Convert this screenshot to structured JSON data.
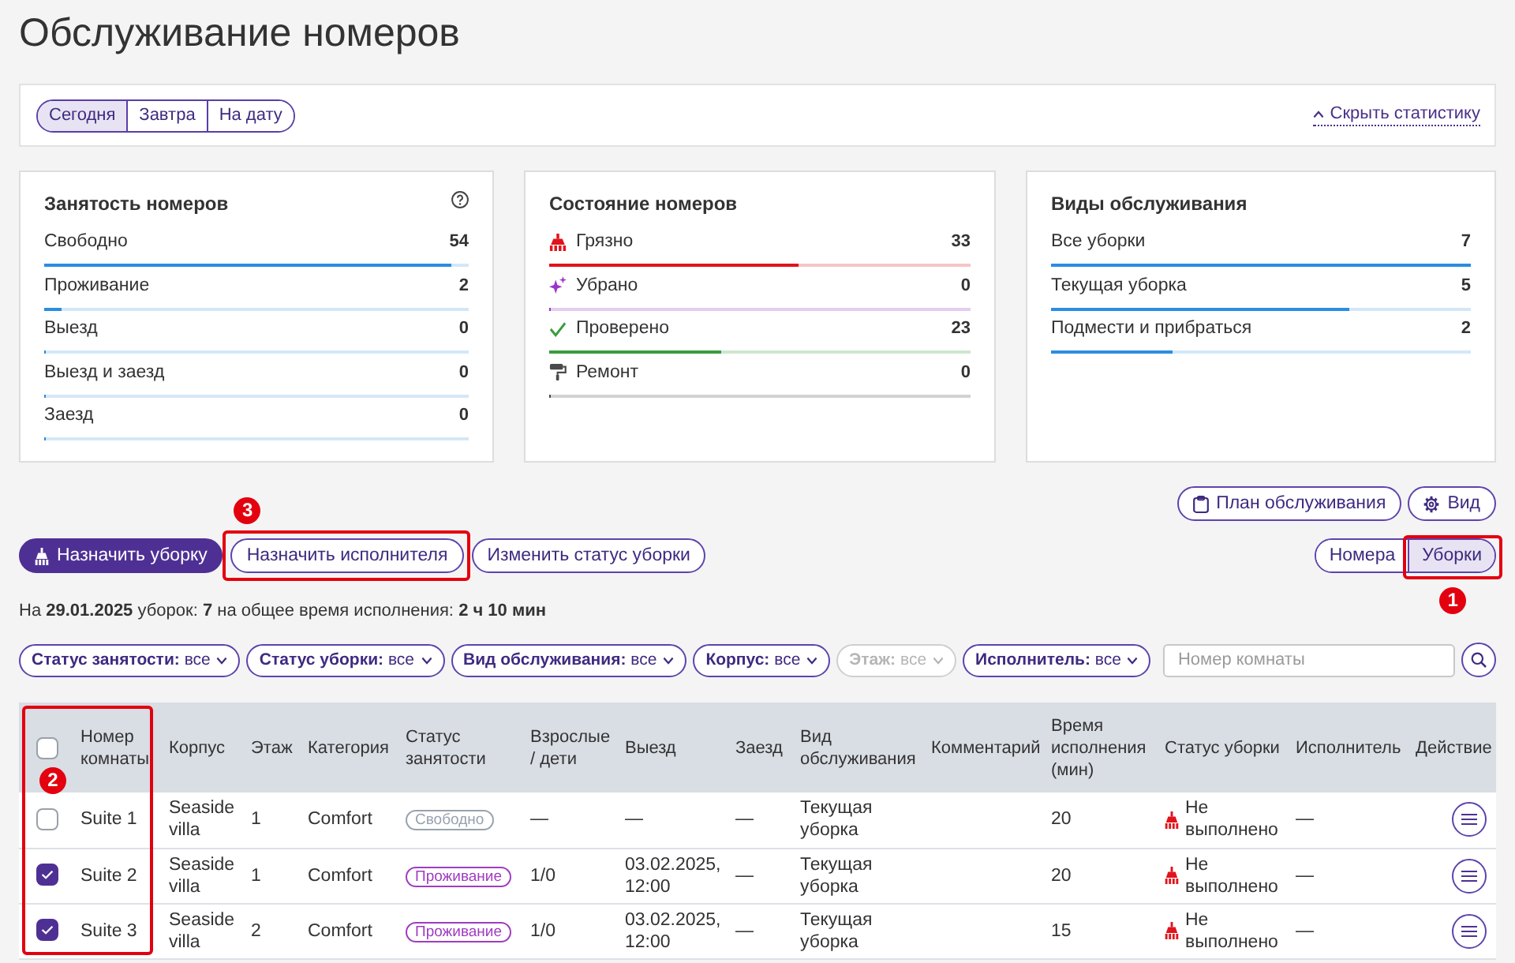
{
  "page": {
    "title": "Обслуживание номеров"
  },
  "date_tabs": [
    {
      "label": "Сегодня",
      "selected": true
    },
    {
      "label": "Завтра",
      "selected": false
    },
    {
      "label": "На дату",
      "selected": false
    }
  ],
  "stats_toggle": {
    "label": "Скрыть статистику"
  },
  "stat_cards": [
    {
      "title": "Занятость номеров",
      "help": true,
      "rows": [
        {
          "label": "Свободно",
          "value": "54",
          "level": 0.96
        },
        {
          "label": "Проживание",
          "value": "2",
          "level": 0.04
        },
        {
          "label": "Выезд",
          "value": "0",
          "level": 0
        },
        {
          "label": "Выезд и заезд",
          "value": "0",
          "level": 0
        },
        {
          "label": "Заезд",
          "value": "0",
          "level": 0
        }
      ]
    },
    {
      "title": "Состояние номеров",
      "rows": [
        {
          "kind": "dirty",
          "label": "Грязно",
          "value": "33",
          "level": 0.59,
          "color": "#e0141c"
        },
        {
          "kind": "cleaned",
          "label": "Убрано",
          "value": "0",
          "level": 0,
          "color": "#9b34c9"
        },
        {
          "kind": "inspected",
          "label": "Проверено",
          "value": "23",
          "level": 0.41,
          "color": "#3a9c3f"
        },
        {
          "kind": "repair",
          "label": "Ремонт",
          "value": "0",
          "level": 0,
          "color": "#4a4a4a"
        }
      ]
    },
    {
      "title": "Виды обслуживания",
      "rows": [
        {
          "label": "Все уборки",
          "value": "7",
          "level": 1
        },
        {
          "label": "Текущая уборка",
          "value": "5",
          "level": 0.71
        },
        {
          "label": "Подмести и прибраться",
          "value": "2",
          "level": 0.29
        }
      ]
    }
  ],
  "top_actions": [
    {
      "kind": "plan",
      "label": "План обслуживания"
    },
    {
      "kind": "view",
      "label": "Вид"
    }
  ],
  "actions": [
    {
      "kind": "primary",
      "label": "Назначить уборку"
    },
    {
      "kind": "outline",
      "label": "Назначить исполнителя",
      "callout": "3"
    },
    {
      "kind": "outline",
      "label": "Изменить статус уборки"
    }
  ],
  "view_toggle": [
    {
      "label": "Номера",
      "selected": false
    },
    {
      "label": "Уборки",
      "selected": true,
      "callout": "1"
    }
  ],
  "summary": "На **29.01.2025** уборок: **7** на общее время исполнения: **2 ч 10 мин**",
  "filters": [
    {
      "label": "Статус занятости:",
      "value": "все",
      "disabled": false
    },
    {
      "label": "Статус уборки:",
      "value": "все",
      "disabled": false
    },
    {
      "label": "Вид обслуживания:",
      "value": "все",
      "disabled": false
    },
    {
      "label": "Корпус:",
      "value": "все",
      "disabled": false
    },
    {
      "label": "Этаж:",
      "value": "все",
      "disabled": true
    },
    {
      "label": "Исполнитель:",
      "value": "все",
      "disabled": false
    }
  ],
  "room_search": {
    "placeholder": "Номер комнаты"
  },
  "table": {
    "callout": "2",
    "select_all": {
      "checked": false
    },
    "columns": [
      "Номер комнаты",
      "Корпус",
      "Этаж",
      "Категория",
      "Статус занятости",
      "Взрослые / дети",
      "Выезд",
      "Заезд",
      "Вид обслуживания",
      "Комментарий",
      "Время исполнения (мин)",
      "Статус уборки",
      "Исполнитель",
      "Действие"
    ],
    "rows": [
      {
        "selected": false,
        "room": "Suite 1",
        "building": "Seaside villa",
        "floor": "1",
        "category": "Comfort",
        "occupancy": {
          "label": "Свободно",
          "color": "#98a2ae"
        },
        "guests": "—",
        "departure": "—",
        "arrival": "—",
        "service": "Текущая уборка",
        "time": "20",
        "cleaning_status": {
          "kind": "not_done",
          "label": "Не выполнено"
        },
        "executor": "—"
      },
      {
        "selected": true,
        "room": "Suite 2",
        "building": "Seaside villa",
        "floor": "1",
        "category": "Comfort",
        "occupancy": {
          "label": "Проживание",
          "color": "#a03cc0"
        },
        "guests": "1/0",
        "departure": "03.02.2025, 12:00",
        "arrival": "—",
        "service": "Текущая уборка",
        "time": "20",
        "cleaning_status": {
          "kind": "not_done",
          "label": "Не выполнено"
        },
        "executor": "—"
      },
      {
        "selected": true,
        "room": "Suite 3",
        "building": "Seaside villa",
        "floor": "2",
        "category": "Comfort",
        "occupancy": {
          "label": "Проживание",
          "color": "#a03cc0"
        },
        "guests": "1/0",
        "departure": "03.02.2025, 12:00",
        "arrival": "—",
        "service": "Текущая уборка",
        "time": "15",
        "cleaning_status": {
          "kind": "not_done",
          "label": "Не выполнено"
        },
        "executor": "—"
      }
    ]
  }
}
